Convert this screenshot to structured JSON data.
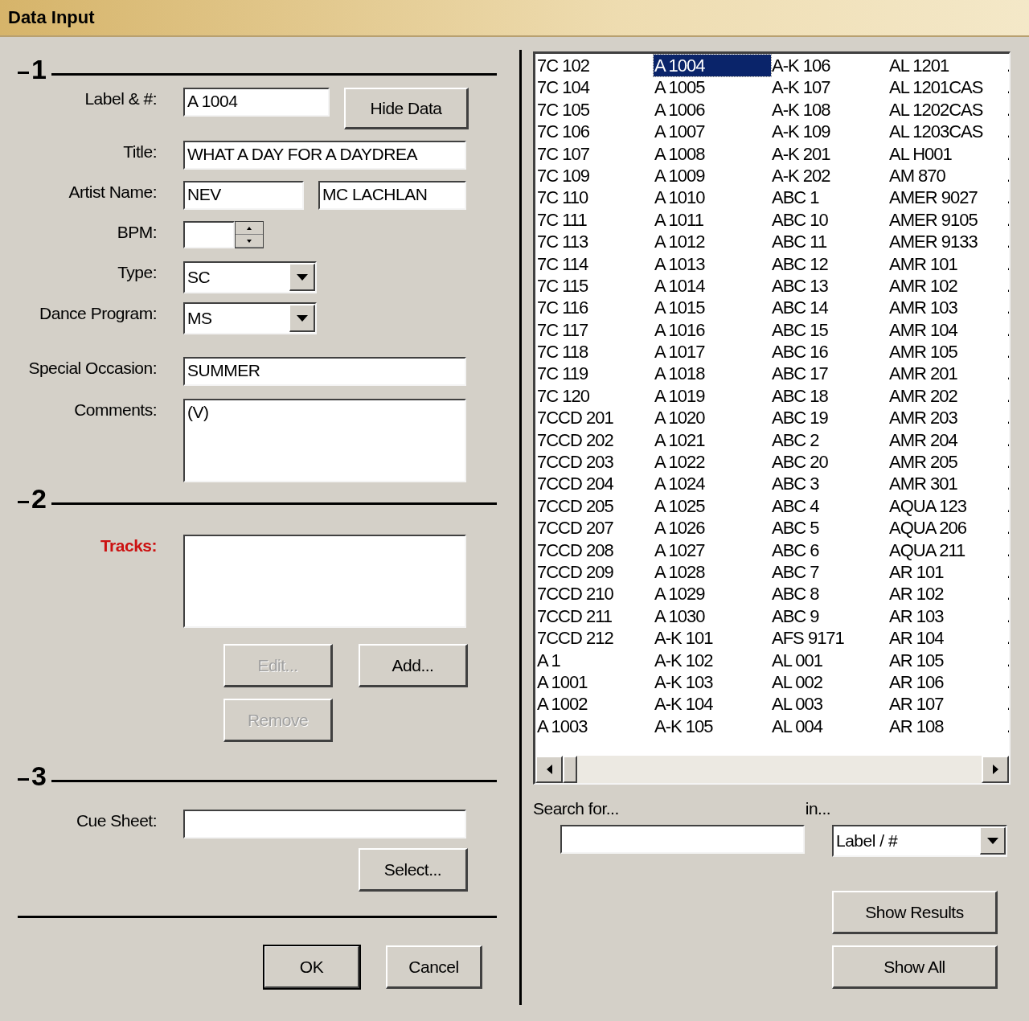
{
  "window": {
    "title": "Data Input"
  },
  "section_1": {
    "number": "1",
    "label_field": {
      "label": "Label & #:",
      "value": "A 1004"
    },
    "hide_data_button": {
      "label": "Hide Data"
    },
    "title_field": {
      "label": "Title:",
      "value": "WHAT A DAY FOR A DAYDREA"
    },
    "artist_field": {
      "label": "Artist Name:",
      "first_name": "NEV",
      "last_name": "MC LACHLAN"
    },
    "bpm_field": {
      "label": "BPM:"
    },
    "type_field": {
      "label": "Type:",
      "value": "SC"
    },
    "dance_program_field": {
      "label": "Dance Program:",
      "value": "MS"
    },
    "special_occasion_field": {
      "label": "Special Occasion:",
      "value": "SUMMER"
    },
    "comments_field": {
      "label": "Comments:",
      "value": "(V)"
    }
  },
  "section_2": {
    "number": "2",
    "tracks": {
      "label": "Tracks:"
    },
    "buttons": [
      {
        "label": "Edit...",
        "disabled": true
      },
      {
        "label": "Add...",
        "disabled": false
      },
      {
        "label": "Remove",
        "disabled": true
      }
    ]
  },
  "section_3": {
    "number": "3",
    "cue_sheet": {
      "label": "Cue Sheet:"
    },
    "select_button": {
      "label": "Select..."
    }
  },
  "dialog_buttons": [
    {
      "label": "OK",
      "default": true
    },
    {
      "label": "Cancel",
      "default": false
    }
  ],
  "record_list": {
    "columns": [
      [
        {
          "text": "7C 102",
          "selected": false
        },
        {
          "text": "7C 104",
          "selected": false
        },
        {
          "text": "7C 105",
          "selected": false
        },
        {
          "text": "7C 106",
          "selected": false
        },
        {
          "text": "7C 107",
          "selected": false
        },
        {
          "text": "7C 109",
          "selected": false
        },
        {
          "text": "7C 110",
          "selected": false
        },
        {
          "text": "7C 111",
          "selected": false
        },
        {
          "text": "7C 113",
          "selected": false
        },
        {
          "text": "7C 114",
          "selected": false
        },
        {
          "text": "7C 115",
          "selected": false
        },
        {
          "text": "7C 116",
          "selected": false
        },
        {
          "text": "7C 117",
          "selected": false
        },
        {
          "text": "7C 118",
          "selected": false
        },
        {
          "text": "7C 119",
          "selected": false
        },
        {
          "text": "7C 120",
          "selected": false
        },
        {
          "text": "7CCD 201",
          "selected": false
        },
        {
          "text": "7CCD 202",
          "selected": false
        },
        {
          "text": "7CCD 203",
          "selected": false
        },
        {
          "text": "7CCD 204",
          "selected": false
        },
        {
          "text": "7CCD 205",
          "selected": false
        },
        {
          "text": "7CCD 207",
          "selected": false
        },
        {
          "text": "7CCD 208",
          "selected": false
        },
        {
          "text": "7CCD 209",
          "selected": false
        },
        {
          "text": "7CCD 210",
          "selected": false
        },
        {
          "text": "7CCD 211",
          "selected": false
        },
        {
          "text": "7CCD 212",
          "selected": false
        },
        {
          "text": "A 1",
          "selected": false
        },
        {
          "text": "A 1001",
          "selected": false
        },
        {
          "text": "A 1002",
          "selected": false
        },
        {
          "text": "A 1003",
          "selected": false
        }
      ],
      [
        {
          "text": "A 1004",
          "selected": true
        },
        {
          "text": "A 1005",
          "selected": false
        },
        {
          "text": "A 1006",
          "selected": false
        },
        {
          "text": "A 1007",
          "selected": false
        },
        {
          "text": "A 1008",
          "selected": false
        },
        {
          "text": "A 1009",
          "selected": false
        },
        {
          "text": "A 1010",
          "selected": false
        },
        {
          "text": "A 1011",
          "selected": false
        },
        {
          "text": "A 1012",
          "selected": false
        },
        {
          "text": "A 1013",
          "selected": false
        },
        {
          "text": "A 1014",
          "selected": false
        },
        {
          "text": "A 1015",
          "selected": false
        },
        {
          "text": "A 1016",
          "selected": false
        },
        {
          "text": "A 1017",
          "selected": false
        },
        {
          "text": "A 1018",
          "selected": false
        },
        {
          "text": "A 1019",
          "selected": false
        },
        {
          "text": "A 1020",
          "selected": false
        },
        {
          "text": "A 1021",
          "selected": false
        },
        {
          "text": "A 1022",
          "selected": false
        },
        {
          "text": "A 1024",
          "selected": false
        },
        {
          "text": "A 1025",
          "selected": false
        },
        {
          "text": "A 1026",
          "selected": false
        },
        {
          "text": "A 1027",
          "selected": false
        },
        {
          "text": "A 1028",
          "selected": false
        },
        {
          "text": "A 1029",
          "selected": false
        },
        {
          "text": "A 1030",
          "selected": false
        },
        {
          "text": "A-K 101",
          "selected": false
        },
        {
          "text": "A-K 102",
          "selected": false
        },
        {
          "text": "A-K 103",
          "selected": false
        },
        {
          "text": "A-K 104",
          "selected": false
        },
        {
          "text": "A-K 105",
          "selected": false
        }
      ],
      [
        {
          "text": "A-K 106",
          "selected": false
        },
        {
          "text": "A-K 107",
          "selected": false
        },
        {
          "text": "A-K 108",
          "selected": false
        },
        {
          "text": "A-K 109",
          "selected": false
        },
        {
          "text": "A-K 201",
          "selected": false
        },
        {
          "text": "A-K 202",
          "selected": false
        },
        {
          "text": "ABC 1",
          "selected": false
        },
        {
          "text": "ABC 10",
          "selected": false
        },
        {
          "text": "ABC 11",
          "selected": false
        },
        {
          "text": "ABC 12",
          "selected": false
        },
        {
          "text": "ABC 13",
          "selected": false
        },
        {
          "text": "ABC 14",
          "selected": false
        },
        {
          "text": "ABC 15",
          "selected": false
        },
        {
          "text": "ABC 16",
          "selected": false
        },
        {
          "text": "ABC 17",
          "selected": false
        },
        {
          "text": "ABC 18",
          "selected": false
        },
        {
          "text": "ABC 19",
          "selected": false
        },
        {
          "text": "ABC 2",
          "selected": false
        },
        {
          "text": "ABC 20",
          "selected": false
        },
        {
          "text": "ABC 3",
          "selected": false
        },
        {
          "text": "ABC 4",
          "selected": false
        },
        {
          "text": "ABC 5",
          "selected": false
        },
        {
          "text": "ABC 6",
          "selected": false
        },
        {
          "text": "ABC 7",
          "selected": false
        },
        {
          "text": "ABC 8",
          "selected": false
        },
        {
          "text": "ABC 9",
          "selected": false
        },
        {
          "text": "AFS 9171",
          "selected": false
        },
        {
          "text": "AL 001",
          "selected": false
        },
        {
          "text": "AL 002",
          "selected": false
        },
        {
          "text": "AL 003",
          "selected": false
        },
        {
          "text": "AL 004",
          "selected": false
        }
      ],
      [
        {
          "text": "AL 1201",
          "selected": false
        },
        {
          "text": "AL 1201CAS",
          "selected": false
        },
        {
          "text": "AL 1202CAS",
          "selected": false
        },
        {
          "text": "AL 1203CAS",
          "selected": false
        },
        {
          "text": "AL H001",
          "selected": false
        },
        {
          "text": "AM 870",
          "selected": false
        },
        {
          "text": "AMER 9027",
          "selected": false
        },
        {
          "text": "AMER 9105",
          "selected": false
        },
        {
          "text": "AMER 9133",
          "selected": false
        },
        {
          "text": "AMR 101",
          "selected": false
        },
        {
          "text": "AMR 102",
          "selected": false
        },
        {
          "text": "AMR 103",
          "selected": false
        },
        {
          "text": "AMR 104",
          "selected": false
        },
        {
          "text": "AMR 105",
          "selected": false
        },
        {
          "text": "AMR 201",
          "selected": false
        },
        {
          "text": "AMR 202",
          "selected": false
        },
        {
          "text": "AMR 203",
          "selected": false
        },
        {
          "text": "AMR 204",
          "selected": false
        },
        {
          "text": "AMR 205",
          "selected": false
        },
        {
          "text": "AMR 301",
          "selected": false
        },
        {
          "text": "AQUA 123",
          "selected": false
        },
        {
          "text": "AQUA 206",
          "selected": false
        },
        {
          "text": "AQUA 211",
          "selected": false
        },
        {
          "text": "AR 101",
          "selected": false
        },
        {
          "text": "AR 102",
          "selected": false
        },
        {
          "text": "AR 103",
          "selected": false
        },
        {
          "text": "AR 104",
          "selected": false
        },
        {
          "text": "AR 105",
          "selected": false
        },
        {
          "text": "AR 106",
          "selected": false
        },
        {
          "text": "AR 107",
          "selected": false
        },
        {
          "text": "AR 108",
          "selected": false
        }
      ],
      [
        {
          "text": ".",
          "selected": false
        },
        {
          "text": ".",
          "selected": false
        },
        {
          "text": ".",
          "selected": false
        },
        {
          "text": ".",
          "selected": false
        },
        {
          "text": ".",
          "selected": false
        },
        {
          "text": ".",
          "selected": false
        },
        {
          "text": ".",
          "selected": false
        },
        {
          "text": ".",
          "selected": false
        },
        {
          "text": ".",
          "selected": false
        },
        {
          "text": ".",
          "selected": false
        },
        {
          "text": ".",
          "selected": false
        },
        {
          "text": ".",
          "selected": false
        },
        {
          "text": ".",
          "selected": false
        },
        {
          "text": ".",
          "selected": false
        },
        {
          "text": ".",
          "selected": false
        },
        {
          "text": ".",
          "selected": false
        },
        {
          "text": ".",
          "selected": false
        },
        {
          "text": ".",
          "selected": false
        },
        {
          "text": ".",
          "selected": false
        },
        {
          "text": ".",
          "selected": false
        },
        {
          "text": ".",
          "selected": false
        },
        {
          "text": ".",
          "selected": false
        },
        {
          "text": ".",
          "selected": false
        },
        {
          "text": ".",
          "selected": false
        },
        {
          "text": ".",
          "selected": false
        },
        {
          "text": ".",
          "selected": false
        },
        {
          "text": ".",
          "selected": false
        },
        {
          "text": ".",
          "selected": false
        },
        {
          "text": ".",
          "selected": false
        },
        {
          "text": ".",
          "selected": false
        },
        {
          "text": ".",
          "selected": false
        }
      ]
    ]
  },
  "search": {
    "label": "Search for...",
    "in_label": "in...",
    "in_value": "Label / #"
  },
  "side_buttons": [
    {
      "label": "Show Results"
    },
    {
      "label": "Show All"
    }
  ]
}
